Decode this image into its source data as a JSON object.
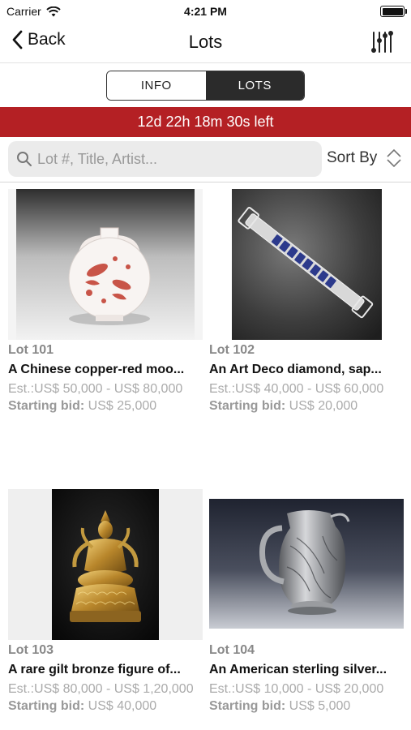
{
  "status_bar": {
    "carrier": "Carrier",
    "time": "4:21 PM"
  },
  "nav": {
    "back_label": "Back",
    "title": "Lots"
  },
  "segments": {
    "info": "INFO",
    "lots": "LOTS",
    "selected": "LOTS"
  },
  "countdown": "12d 22h 18m 30s left",
  "search": {
    "placeholder": "Lot #, Title, Artist...",
    "value": ""
  },
  "sort_label": "Sort By",
  "colors": {
    "accent_red": "#b42024",
    "segment_dark": "#2b2b2b",
    "search_bg": "#ebebeb"
  },
  "starting_bid_label": "Starting bid:",
  "lots": [
    {
      "number": "Lot 101",
      "title": "A Chinese copper-red moo...",
      "estimate": "Est.:US$ 50,000 - US$ 80,000",
      "starting_bid": "US$ 25,000",
      "image": "moon-flask-vase"
    },
    {
      "number": "Lot 102",
      "title": "An Art Deco diamond, sap...",
      "estimate": "Est.:US$ 40,000 - US$ 60,000",
      "starting_bid": "US$ 20,000",
      "image": "diamond-bracelet"
    },
    {
      "number": "Lot 103",
      "title": "A rare gilt bronze figure of...",
      "estimate": "Est.:US$ 80,000 - US$ 1,20,000",
      "starting_bid": "US$ 40,000",
      "image": "gilt-bronze-figure"
    },
    {
      "number": "Lot 104",
      "title": "An American sterling silver...",
      "estimate": "Est.:US$ 10,000 - US$ 20,000",
      "starting_bid": "US$ 5,000",
      "image": "silver-pitcher"
    }
  ]
}
